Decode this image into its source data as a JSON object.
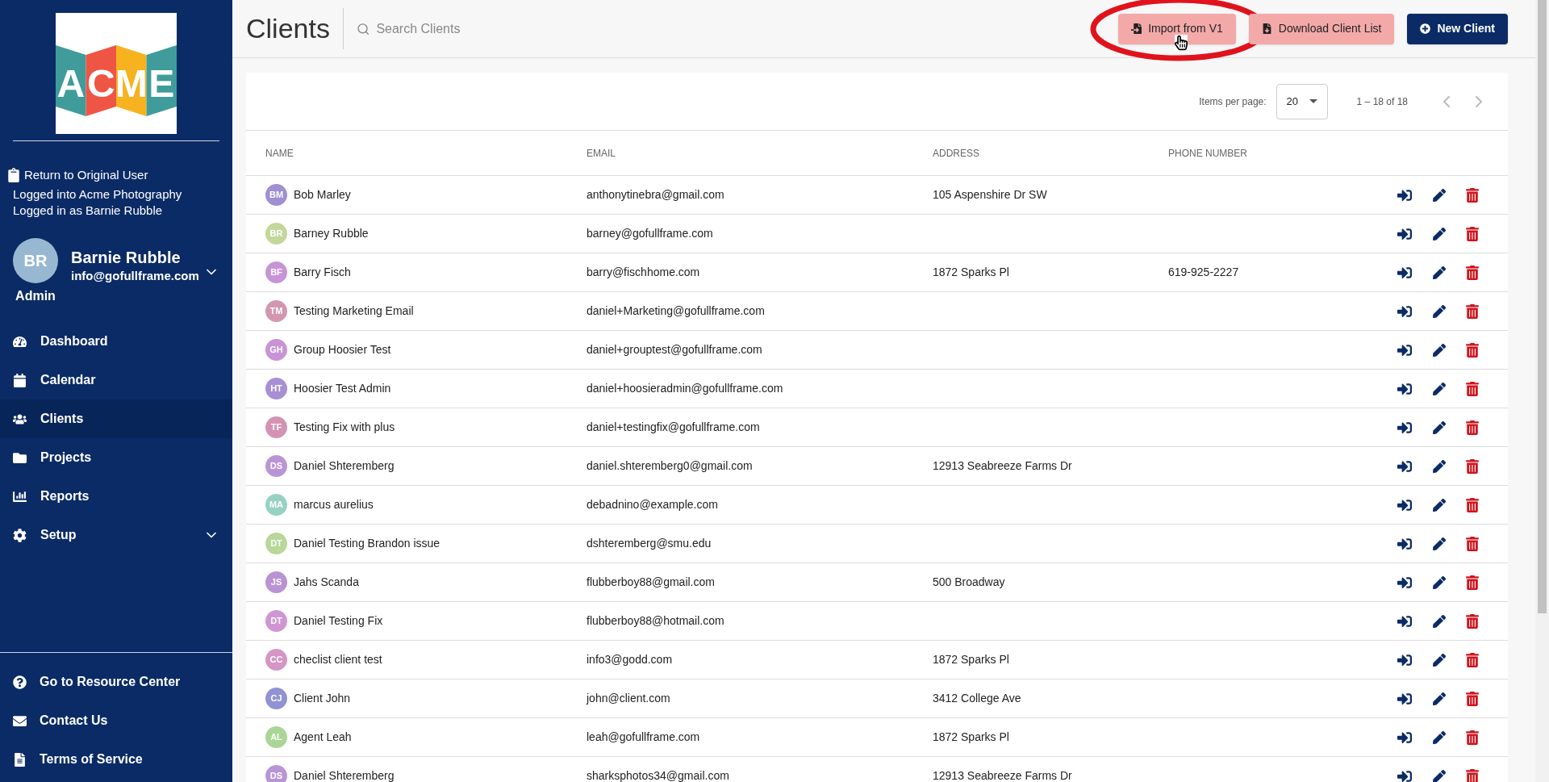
{
  "logo": {
    "letters": [
      "A",
      "C",
      "M",
      "E"
    ]
  },
  "session": {
    "return_link": "Return to Original User",
    "logged_into": "Logged into Acme Photography",
    "logged_as": "Logged in as Barnie Rubble"
  },
  "user": {
    "initials": "BR",
    "role": "Admin",
    "name": "Barnie Rubble",
    "email": "info@gofullframe.com"
  },
  "nav": [
    {
      "kind": "dashboard",
      "label": "Dashboard",
      "selected": false,
      "expandable": false
    },
    {
      "kind": "calendar",
      "label": "Calendar",
      "selected": false,
      "expandable": false
    },
    {
      "kind": "clients",
      "label": "Clients",
      "selected": true,
      "expandable": false
    },
    {
      "kind": "projects",
      "label": "Projects",
      "selected": false,
      "expandable": false
    },
    {
      "kind": "reports",
      "label": "Reports",
      "selected": false,
      "expandable": false
    },
    {
      "kind": "setup",
      "label": "Setup",
      "selected": false,
      "expandable": true
    }
  ],
  "footer_nav": [
    {
      "kind": "help",
      "label": "Go to Resource Center"
    },
    {
      "kind": "mail",
      "label": "Contact Us"
    },
    {
      "kind": "document",
      "label": "Terms of Service"
    }
  ],
  "header": {
    "title": "Clients",
    "search_placeholder": "Search Clients",
    "buttons": [
      {
        "kind": "import",
        "label": "Import from V1",
        "highlighted": true
      },
      {
        "kind": "download",
        "label": "Download Client List",
        "highlighted": false
      },
      {
        "kind": "new",
        "label": "New Client",
        "highlighted": false
      }
    ]
  },
  "pager": {
    "label": "Items per page:",
    "per_page": "20",
    "range": "1 – 18 of 18"
  },
  "table": {
    "columns": [
      "NAME",
      "EMAIL",
      "ADDRESS",
      "PHONE NUMBER"
    ],
    "rows": [
      {
        "initials": "BM",
        "color": "#a08fd2",
        "name": "Bob Marley",
        "email": "anthonytinebra@gmail.com",
        "address": "105 Aspenshire Dr SW",
        "phone": ""
      },
      {
        "initials": "BR",
        "color": "#c3d79b",
        "name": "Barney Rubble",
        "email": "barney@gofullframe.com",
        "address": "",
        "phone": ""
      },
      {
        "initials": "BF",
        "color": "#c795d6",
        "name": "Barry Fisch",
        "email": "barry@fischhome.com",
        "address": "1872 Sparks Pl",
        "phone": "619-925-2227"
      },
      {
        "initials": "TM",
        "color": "#d396b0",
        "name": "Testing Marketing Email",
        "email": "daniel+Marketing@gofullframe.com",
        "address": "",
        "phone": ""
      },
      {
        "initials": "GH",
        "color": "#c994d6",
        "name": "Group Hoosier Test",
        "email": "daniel+grouptest@gofullframe.com",
        "address": "",
        "phone": ""
      },
      {
        "initials": "HT",
        "color": "#a78fd4",
        "name": "Hoosier Test Admin",
        "email": "daniel+hoosieradmin@gofullframe.com",
        "address": "",
        "phone": ""
      },
      {
        "initials": "TF",
        "color": "#d493b3",
        "name": "Testing Fix with plus",
        "email": "daniel+testingfix@gofullframe.com",
        "address": "",
        "phone": ""
      },
      {
        "initials": "DS",
        "color": "#ba95d6",
        "name": "Daniel Shteremberg",
        "email": "daniel.shteremberg0@gmail.com",
        "address": "12913 Seabreeze Farms Dr",
        "phone": ""
      },
      {
        "initials": "MA",
        "color": "#96d2c2",
        "name": "marcus aurelius",
        "email": "debadnino@example.com",
        "address": "",
        "phone": ""
      },
      {
        "initials": "DT",
        "color": "#b8d799",
        "name": "Daniel Testing Brandon issue",
        "email": "dshteremberg@smu.edu",
        "address": "",
        "phone": ""
      },
      {
        "initials": "JS",
        "color": "#b993d4",
        "name": "Jahs Scanda",
        "email": "flubberboy88@gmail.com",
        "address": "500 Broadway",
        "phone": ""
      },
      {
        "initials": "DT",
        "color": "#d096d4",
        "name": "Daniel Testing Fix",
        "email": "flubberboy88@hotmail.com",
        "address": "",
        "phone": ""
      },
      {
        "initials": "CC",
        "color": "#d596c4",
        "name": "checlist client test",
        "email": "info3@godd.com",
        "address": "1872 Sparks Pl",
        "phone": ""
      },
      {
        "initials": "CJ",
        "color": "#9192d4",
        "name": "Client John",
        "email": "john@client.com",
        "address": "3412 College Ave",
        "phone": ""
      },
      {
        "initials": "AL",
        "color": "#a9d596",
        "name": "Agent Leah",
        "email": "leah@gofullframe.com",
        "address": "1872 Sparks Pl",
        "phone": ""
      },
      {
        "initials": "DS",
        "color": "#b995d4",
        "name": "Daniel Shteremberg",
        "email": "sharksphotos34@gmail.com",
        "address": "12913 Seabreeze Farms Dr",
        "phone": ""
      }
    ]
  }
}
